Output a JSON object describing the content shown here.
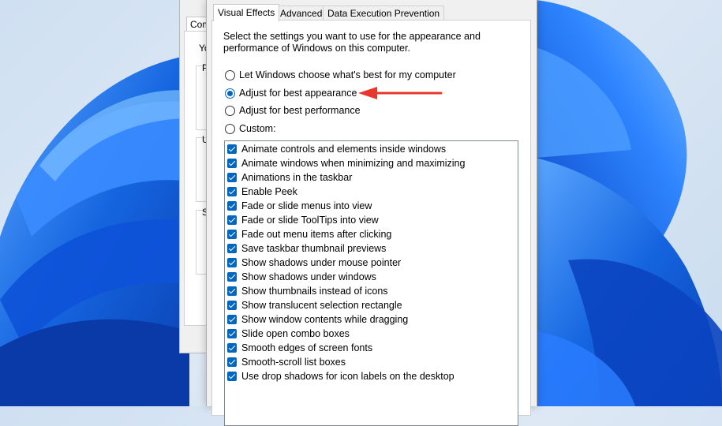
{
  "back_window": {
    "tab_label": "Com",
    "text_1": "Yo",
    "text_2": "P",
    "text_3": "U",
    "text_4": "S"
  },
  "dialog": {
    "tabs": [
      {
        "label": "Visual Effects",
        "active": true
      },
      {
        "label": "Advanced",
        "active": false
      },
      {
        "label": "Data Execution Prevention",
        "active": false
      }
    ],
    "description_line1": "Select the settings you want to use for the appearance and",
    "description_line2": "performance of Windows on this computer.",
    "radio_options": [
      {
        "label": "Let Windows choose what's best for my computer",
        "selected": false
      },
      {
        "label": "Adjust for best appearance",
        "selected": true
      },
      {
        "label": "Adjust for best performance",
        "selected": false
      },
      {
        "label": "Custom:",
        "selected": false
      }
    ],
    "custom_settings": [
      {
        "label": "Animate controls and elements inside windows",
        "checked": true
      },
      {
        "label": "Animate windows when minimizing and maximizing",
        "checked": true
      },
      {
        "label": "Animations in the taskbar",
        "checked": true
      },
      {
        "label": "Enable Peek",
        "checked": true
      },
      {
        "label": "Fade or slide menus into view",
        "checked": true
      },
      {
        "label": "Fade or slide ToolTips into view",
        "checked": true
      },
      {
        "label": "Fade out menu items after clicking",
        "checked": true
      },
      {
        "label": "Save taskbar thumbnail previews",
        "checked": true
      },
      {
        "label": "Show shadows under mouse pointer",
        "checked": true
      },
      {
        "label": "Show shadows under windows",
        "checked": true
      },
      {
        "label": "Show thumbnails instead of icons",
        "checked": true
      },
      {
        "label": "Show translucent selection rectangle",
        "checked": true
      },
      {
        "label": "Show window contents while dragging",
        "checked": true
      },
      {
        "label": "Slide open combo boxes",
        "checked": true
      },
      {
        "label": "Smooth edges of screen fonts",
        "checked": true
      },
      {
        "label": "Smooth-scroll list boxes",
        "checked": true
      },
      {
        "label": "Use drop shadows for icon labels on the desktop",
        "checked": true
      }
    ]
  },
  "colors": {
    "accent": "#0067c0",
    "annotation_arrow": "#e8382d",
    "wallpaper_blue": "#1a6fe0"
  }
}
